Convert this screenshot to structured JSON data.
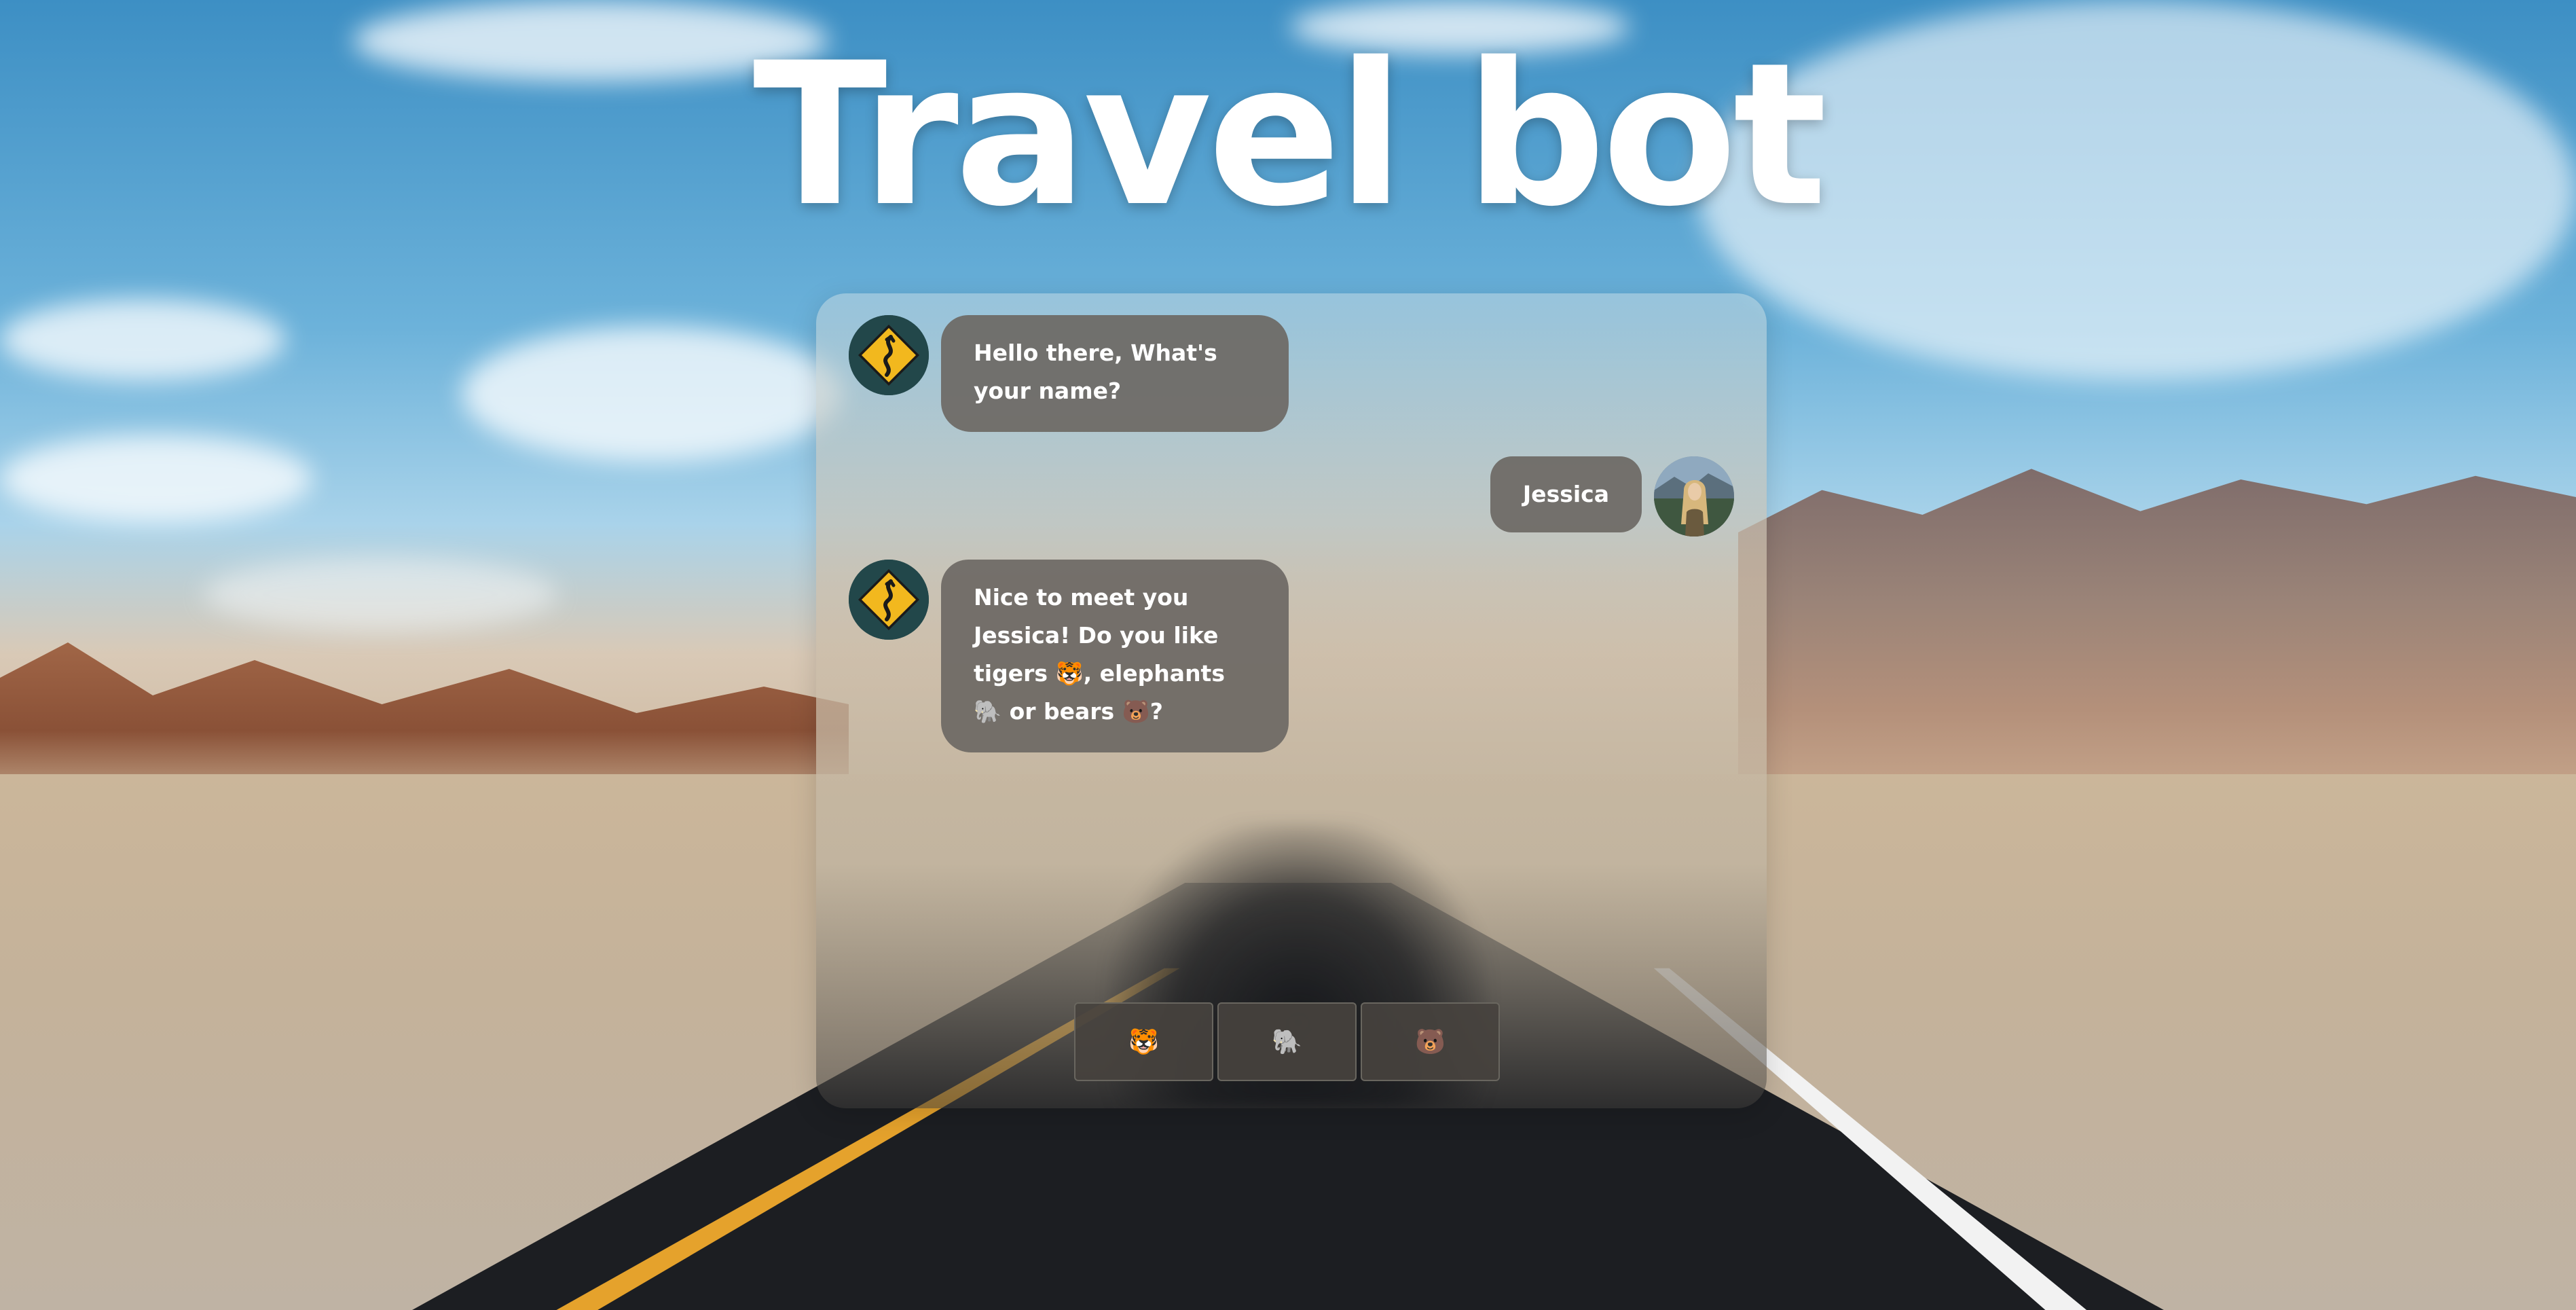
{
  "title": "Travel bot",
  "messages": [
    {
      "sender": "bot",
      "avatar": "winding-road-sign-avatar",
      "text": "Hello there, What's your name?"
    },
    {
      "sender": "user",
      "avatar": "user-photo-avatar",
      "text": "Jessica"
    },
    {
      "sender": "bot",
      "avatar": "winding-road-sign-avatar",
      "text": "Nice to meet you Jessica! Do you like tigers 🐯, elephants 🐘 or bears 🐻?"
    }
  ],
  "options": [
    {
      "label": "🐯",
      "icon": "tiger-icon"
    },
    {
      "label": "🐘",
      "icon": "elephant-icon"
    },
    {
      "label": "🐻",
      "icon": "bear-icon"
    }
  ],
  "colors": {
    "bubble": "#6c6864",
    "option_button": "#46423e",
    "road_sign": "#f2b81e",
    "title": "#ffffff"
  }
}
